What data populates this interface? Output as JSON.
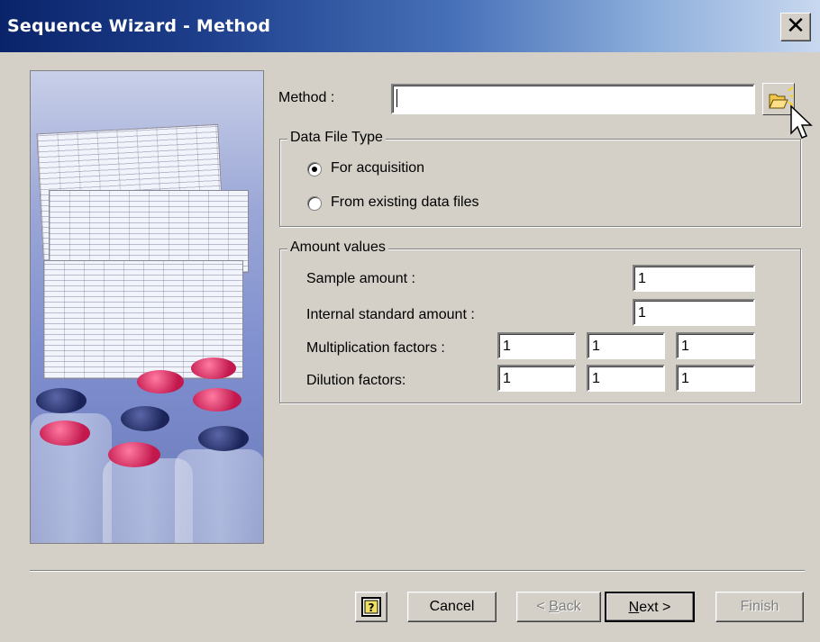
{
  "window": {
    "title": "Sequence Wizard - Method",
    "close_icon": "close-icon"
  },
  "method": {
    "label": "Method :",
    "value": "",
    "browse_icon": "open-folder-icon"
  },
  "data_file_type": {
    "title": "Data File Type",
    "options": [
      {
        "label": "For acquisition",
        "checked": true
      },
      {
        "label": "From existing data files",
        "checked": false
      }
    ]
  },
  "amount_values": {
    "title": "Amount values",
    "sample_amount_label": "Sample amount :",
    "sample_amount": "1",
    "internal_standard_label": "Internal standard amount :",
    "internal_standard": "1",
    "multiplication_label": "Multiplication factors :",
    "multiplication": [
      "1",
      "1",
      "1"
    ],
    "dilution_label": "Dilution factors:",
    "dilution": [
      "1",
      "1",
      "1"
    ]
  },
  "buttons": {
    "help_icon": "help-icon",
    "cancel": "Cancel",
    "back": "< Back",
    "next": "Next >",
    "finish": "Finish"
  }
}
